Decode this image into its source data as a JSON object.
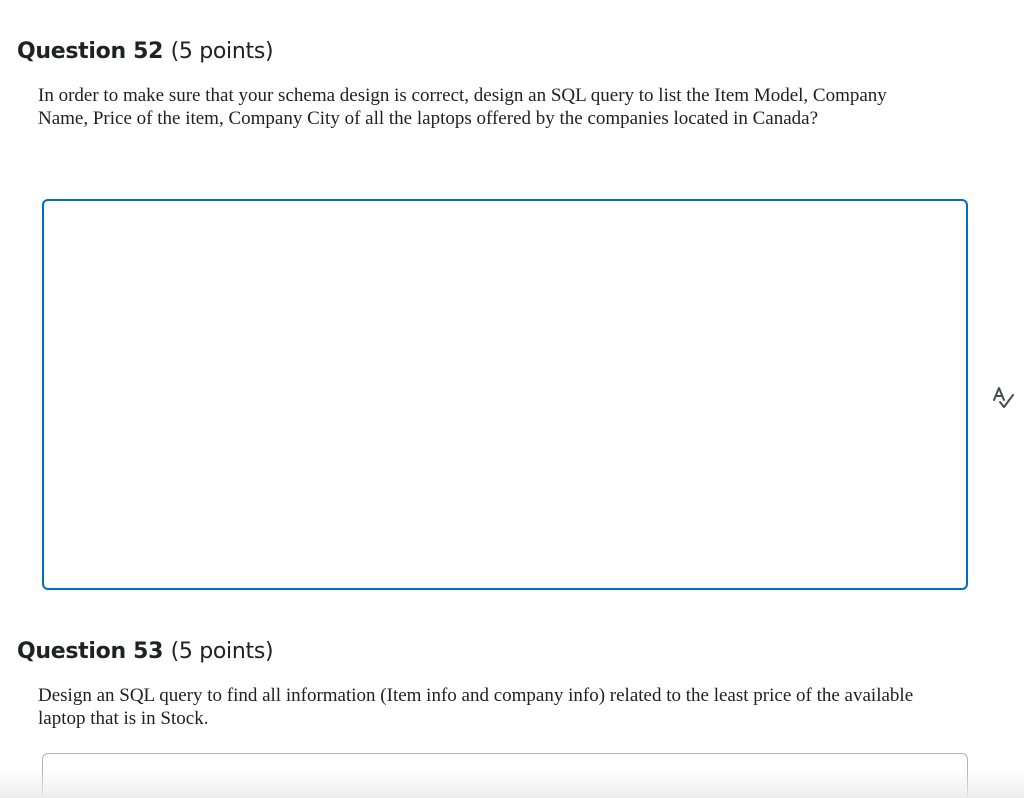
{
  "questions": [
    {
      "number_label": "Question 52",
      "points_label": "(5 points)",
      "prompt": "In order to make sure that your schema design is correct, design an SQL query to list the Item Model, Company Name, Price of the item, Company City of all the laptops offered by the companies located in Canada?",
      "answer_value": ""
    },
    {
      "number_label": "Question 53",
      "points_label": "(5 points)",
      "prompt": "Design an SQL query to find all information (Item info and company info) related to the least price of the available laptop that is in Stock.",
      "answer_value": ""
    }
  ],
  "icons": {
    "spellcheck": "spellcheck-icon"
  },
  "colors": {
    "focus_border": "#006fbf",
    "idle_border": "#b5b5b5",
    "text": "#202122"
  }
}
